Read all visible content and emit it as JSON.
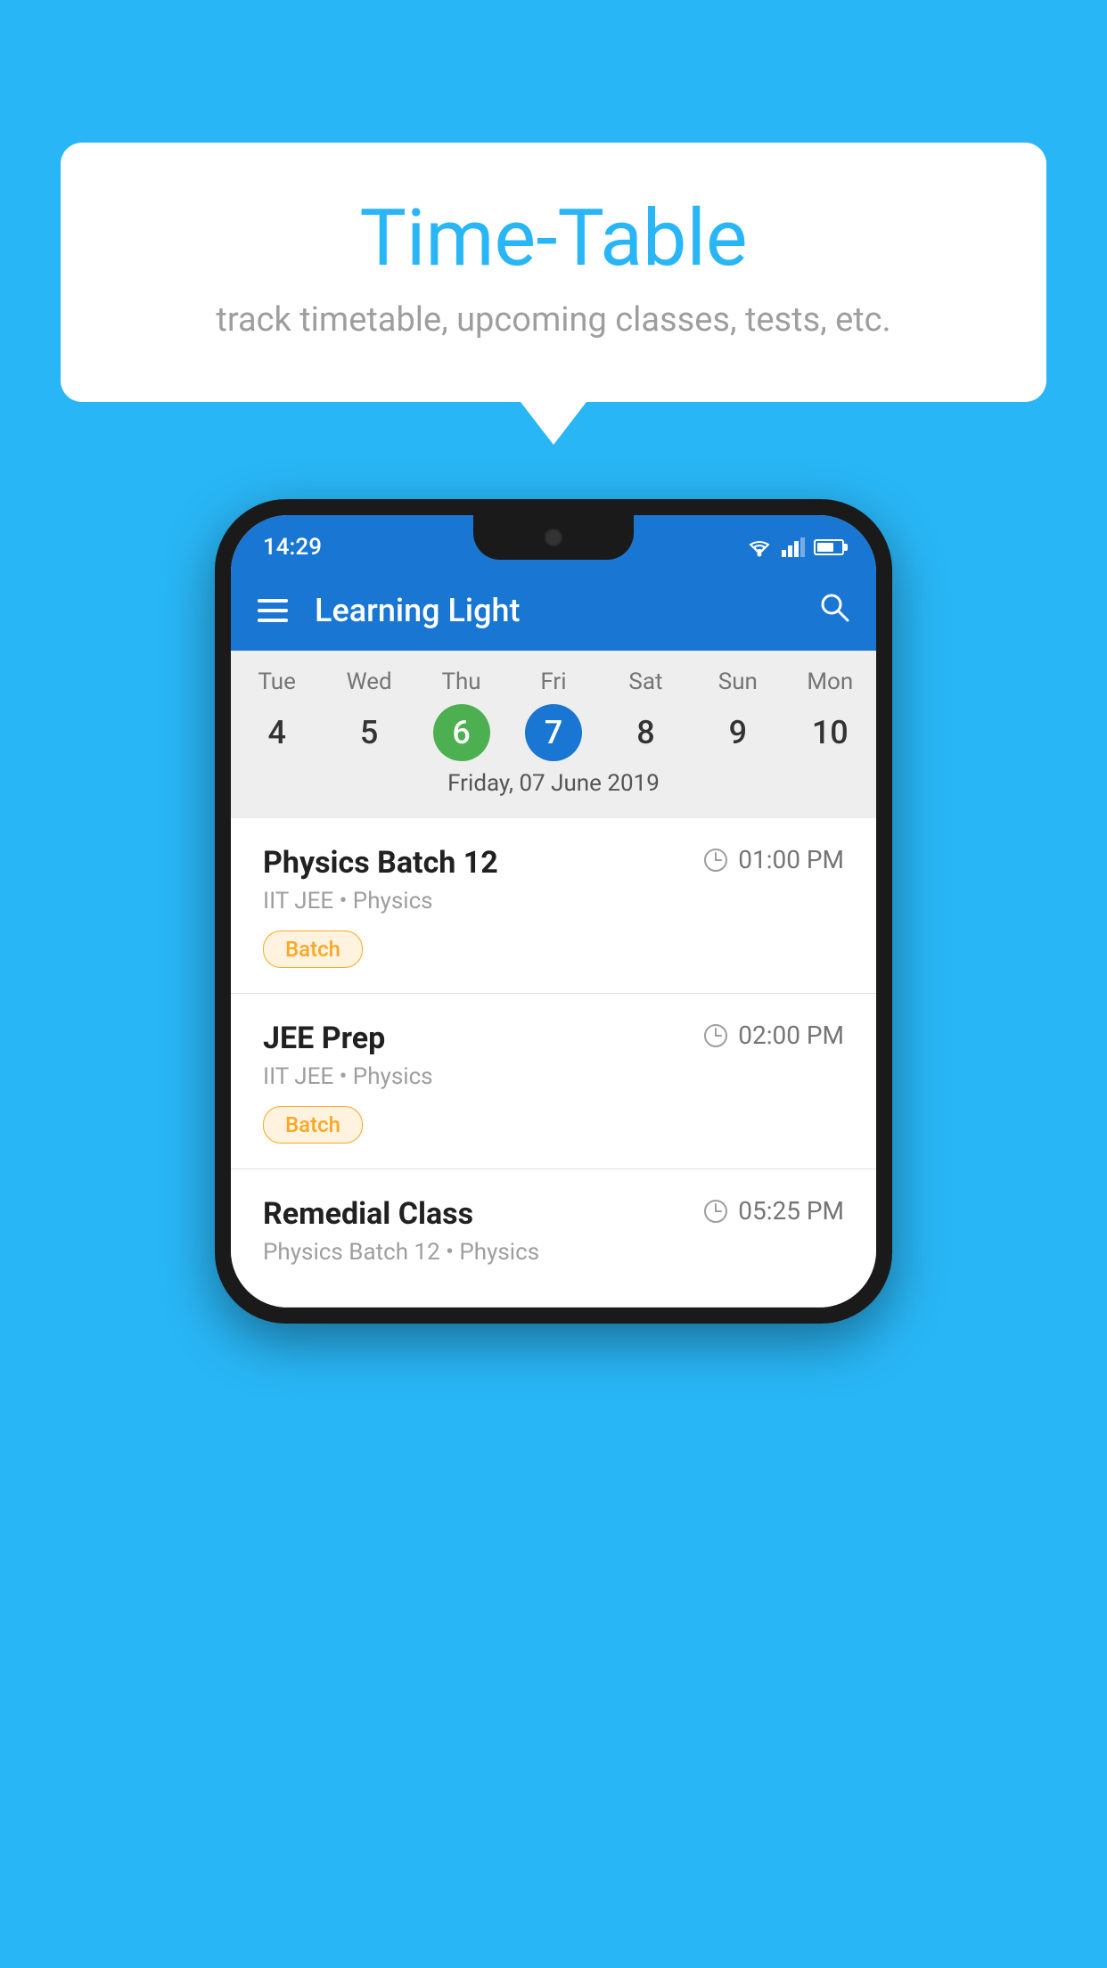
{
  "background": {
    "color": "#29b6f6"
  },
  "bubble": {
    "title": "Time-Table",
    "subtitle": "track timetable, upcoming classes, tests, etc."
  },
  "status_bar": {
    "time": "14:29"
  },
  "app_bar": {
    "title": "Learning Light",
    "search_icon": "🔍"
  },
  "calendar": {
    "days": [
      "Tue",
      "Wed",
      "Thu",
      "Fri",
      "Sat",
      "Sun",
      "Mon"
    ],
    "numbers": [
      "4",
      "5",
      "6",
      "7",
      "8",
      "9",
      "10"
    ],
    "today_index": 2,
    "selected_index": 3,
    "date_label": "Friday, 07 June 2019"
  },
  "schedule": [
    {
      "title": "Physics Batch 12",
      "time": "01:00 PM",
      "subtitle": "IIT JEE • Physics",
      "badge": "Batch"
    },
    {
      "title": "JEE Prep",
      "time": "02:00 PM",
      "subtitle": "IIT JEE • Physics",
      "badge": "Batch"
    },
    {
      "title": "Remedial Class",
      "time": "05:25 PM",
      "subtitle": "Physics Batch 12 • Physics",
      "badge": ""
    }
  ]
}
